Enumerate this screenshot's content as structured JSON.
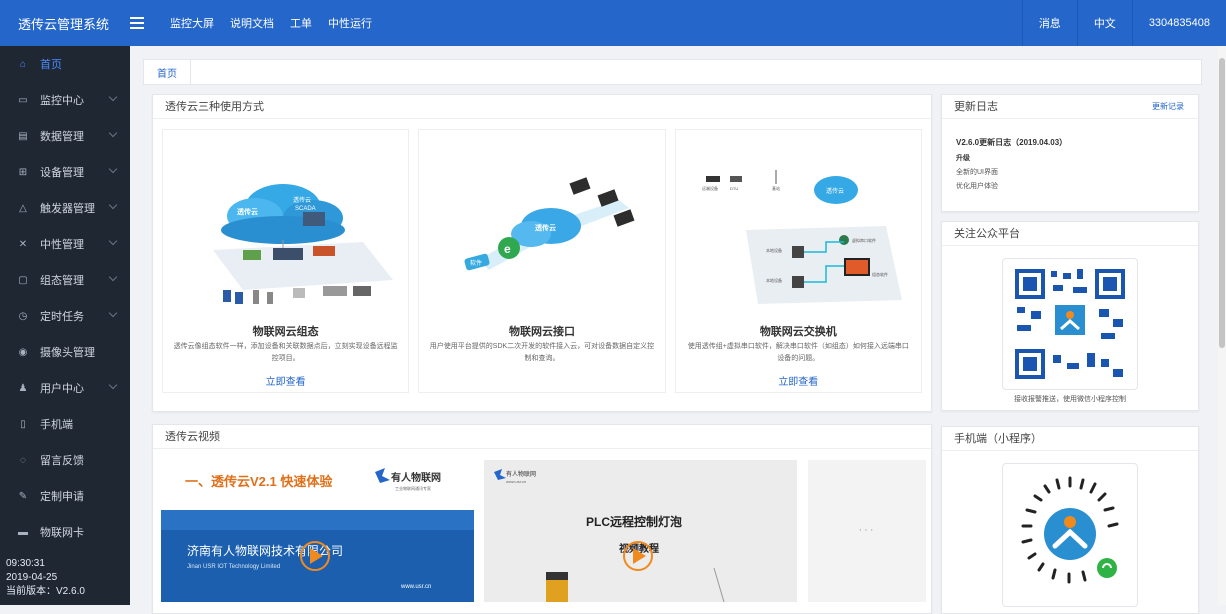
{
  "app": {
    "title": "透传云管理系统"
  },
  "topnav": [
    "监控大屏",
    "说明文档",
    "工单",
    "中性运行"
  ],
  "topright": {
    "messages": "消息",
    "language": "中文",
    "user": "3304835408"
  },
  "sidebar": {
    "items": [
      {
        "label": "首页",
        "icon": "home-icon",
        "active": true,
        "has_children": false
      },
      {
        "label": "监控中心",
        "icon": "monitor-icon",
        "has_children": true
      },
      {
        "label": "数据管理",
        "icon": "database-icon",
        "has_children": true
      },
      {
        "label": "设备管理",
        "icon": "grid-icon",
        "has_children": true
      },
      {
        "label": "触发器管理",
        "icon": "bell-icon",
        "has_children": true
      },
      {
        "label": "中性管理",
        "icon": "tools-icon",
        "has_children": true
      },
      {
        "label": "组态管理",
        "icon": "window-icon",
        "has_children": true
      },
      {
        "label": "定时任务",
        "icon": "clock-icon",
        "has_children": true
      },
      {
        "label": "摄像头管理",
        "icon": "camera-icon",
        "has_children": false
      },
      {
        "label": "用户中心",
        "icon": "user-icon",
        "has_children": true
      },
      {
        "label": "手机端",
        "icon": "phone-icon",
        "has_children": false
      },
      {
        "label": "留言反馈",
        "icon": "chat-icon",
        "has_children": false
      },
      {
        "label": "定制申请",
        "icon": "edit-icon",
        "has_children": false
      },
      {
        "label": "物联网卡",
        "icon": "card-icon",
        "has_children": false
      }
    ],
    "footer": {
      "time": "09:30:31",
      "date": "2019-04-25",
      "version": "当前版本：V2.6.0"
    }
  },
  "tabs": [
    "首页"
  ],
  "usage": {
    "title": "透传云三种使用方式",
    "cards": [
      {
        "title": "物联网云组态",
        "desc": "透传云像组态软件一样，添加设备和关联数据点后，立刻实现设备远程监控项目。",
        "link": "立即查看"
      },
      {
        "title": "物联网云接口",
        "desc": "用户使用平台提供的SDK二次开发的软件接入云，可对设备数据自定义控制和查询。",
        "link": ""
      },
      {
        "title": "物联网云交换机",
        "desc": "使用透传组+虚拟串口软件，解决串口软件（如组态）如何接入远端串口设备的问题。",
        "link": "立即查看"
      }
    ],
    "illus_labels": {
      "cloud": "透传云",
      "scada_cloud": "透传云",
      "scada": "SCADA",
      "software": "软件",
      "remote_device": "远端设备",
      "dtu": "DTU",
      "base_station": "基站",
      "virtual_serial": "虚拟串口软件",
      "local_device_1": "本地设备",
      "local_device_2": "本地设备",
      "scada_software": "组态软件"
    }
  },
  "changelog": {
    "title": "更新日志",
    "link": "更新记录",
    "version": "V2.6.0更新日志（2019.04.03）",
    "heading": "升级",
    "items": [
      "全新的UI界面",
      "优化用户体验"
    ]
  },
  "wechat": {
    "title": "关注公众平台",
    "caption": "接收报警推送，使用微信小程序控制"
  },
  "miniapp": {
    "title": "手机端（小程序）"
  },
  "videos": {
    "title": "透传云视频",
    "v1": {
      "headline": "一、透传云V2.1 快速体验",
      "brand": "有人物联网",
      "brand_sub": "工业物联网通讯专家",
      "company": "济南有人物联网技术有限公司",
      "company_en": "Jinan USR IOT Technology Limited",
      "url": "www.usr.cn"
    },
    "v2": {
      "brand": "有人物联网",
      "brand_url": "www.usr.cn",
      "headline": "PLC远程控制灯泡",
      "sub": "视频教程"
    },
    "more": "···"
  },
  "colors": {
    "primary": "#2466c9",
    "sidebar": "#1f2733",
    "play": "#f08a1f"
  }
}
